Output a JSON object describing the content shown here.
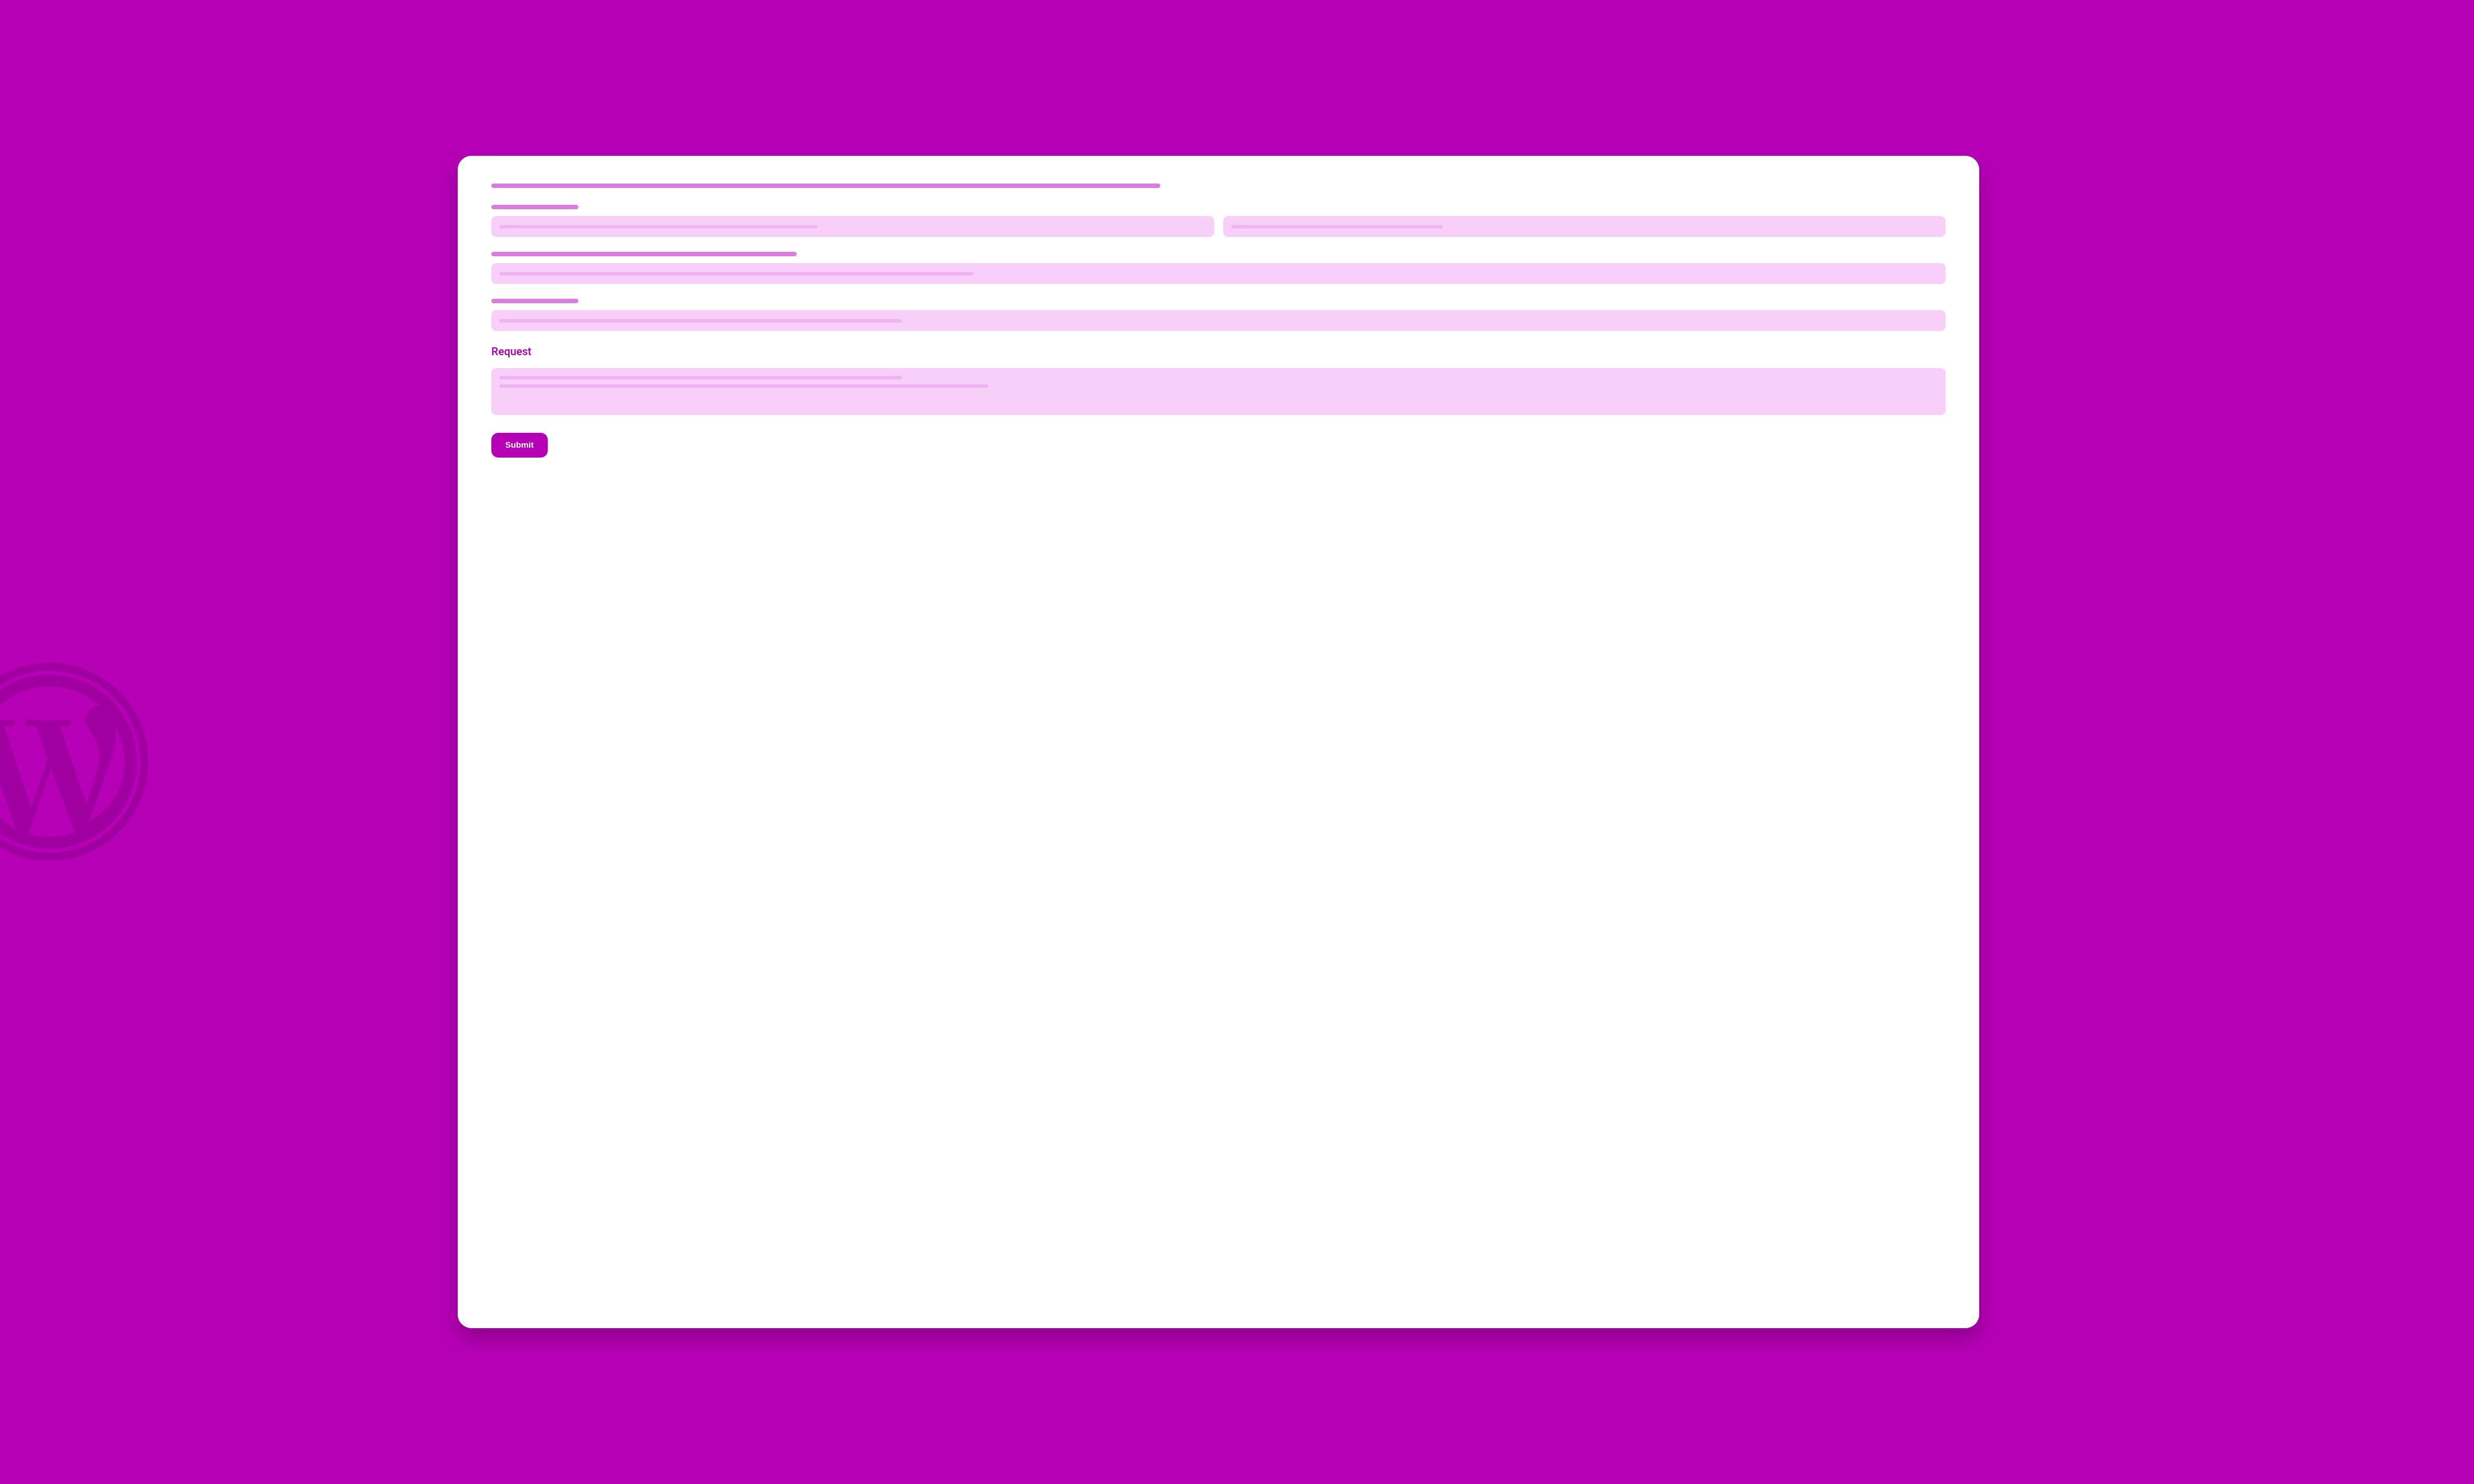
{
  "form": {
    "request_label": "Request",
    "submit_label": "Submit"
  },
  "colors": {
    "background": "#b500b5",
    "card": "#ffffff",
    "field_bg": "#f7cff9",
    "placeholder": "#efb2f2",
    "label_bar": "#d87cdd",
    "accent_text": "#a908a9"
  },
  "icons": {
    "background_logo": "wordpress-logo"
  }
}
